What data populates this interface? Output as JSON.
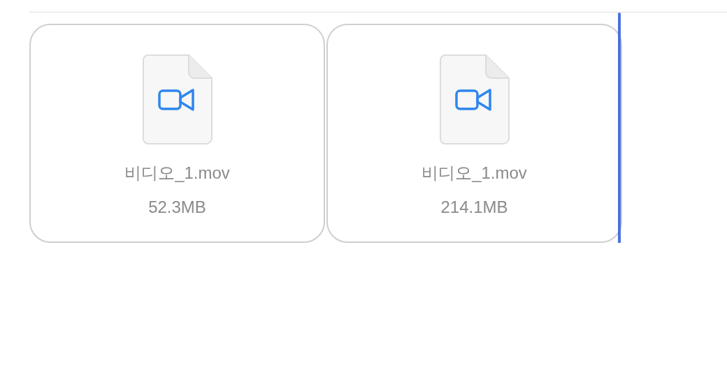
{
  "files": [
    {
      "name": "비디오_1.mov",
      "size": "52.3MB",
      "kind": "video"
    },
    {
      "name": "비디오_1.mov",
      "size": "214.1MB",
      "kind": "video"
    }
  ]
}
